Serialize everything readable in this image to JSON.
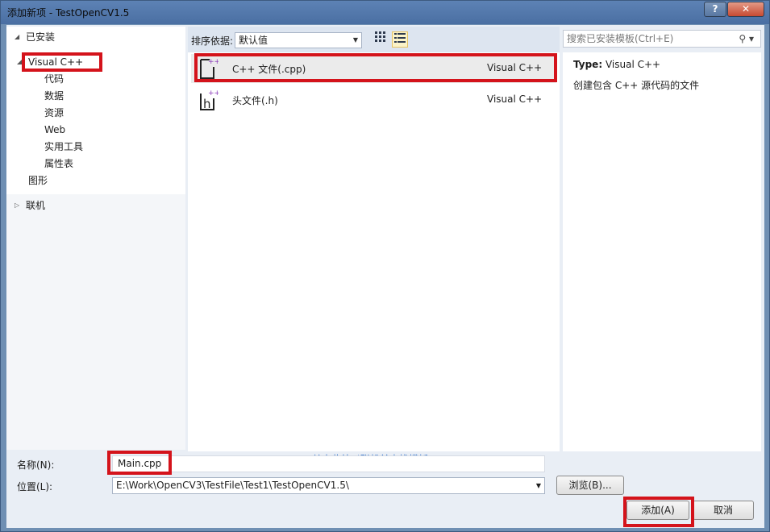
{
  "window": {
    "title": "添加新项 - TestOpenCV1.5",
    "help": "?",
    "close": "✕"
  },
  "tree": {
    "installed": "已安装",
    "visual_cpp": "Visual C++",
    "children": [
      "代码",
      "数据",
      "资源",
      "Web",
      "实用工具",
      "属性表"
    ],
    "graphics": "图形",
    "online": "联机"
  },
  "toolbar": {
    "sort_label": "排序依据:",
    "sort_value": "默认值"
  },
  "templates": [
    {
      "name": "C++ 文件(.cpp)",
      "lang": "Visual C++",
      "selected": true
    },
    {
      "name": "头文件(.h)",
      "lang": "Visual C++",
      "selected": false
    }
  ],
  "online_link": "单击此处以联机并查找模板。",
  "search": {
    "placeholder": "搜索已安装模板(Ctrl+E)"
  },
  "details": {
    "type_label": "Type:",
    "type_value": "Visual C++",
    "description": "创建包含 C++ 源代码的文件"
  },
  "form": {
    "name_label": "名称(N):",
    "name_value": "Main.cpp",
    "location_label": "位置(L):",
    "location_value": "E:\\Work\\OpenCV3\\TestFile\\Test1\\TestOpenCV1.5\\",
    "browse": "浏览(B)...",
    "add": "添加(A)",
    "cancel": "取消"
  },
  "colors": {
    "highlight_box": "#d4131b",
    "link": "#1660c7",
    "icon_accent": "#8a3ab9"
  }
}
